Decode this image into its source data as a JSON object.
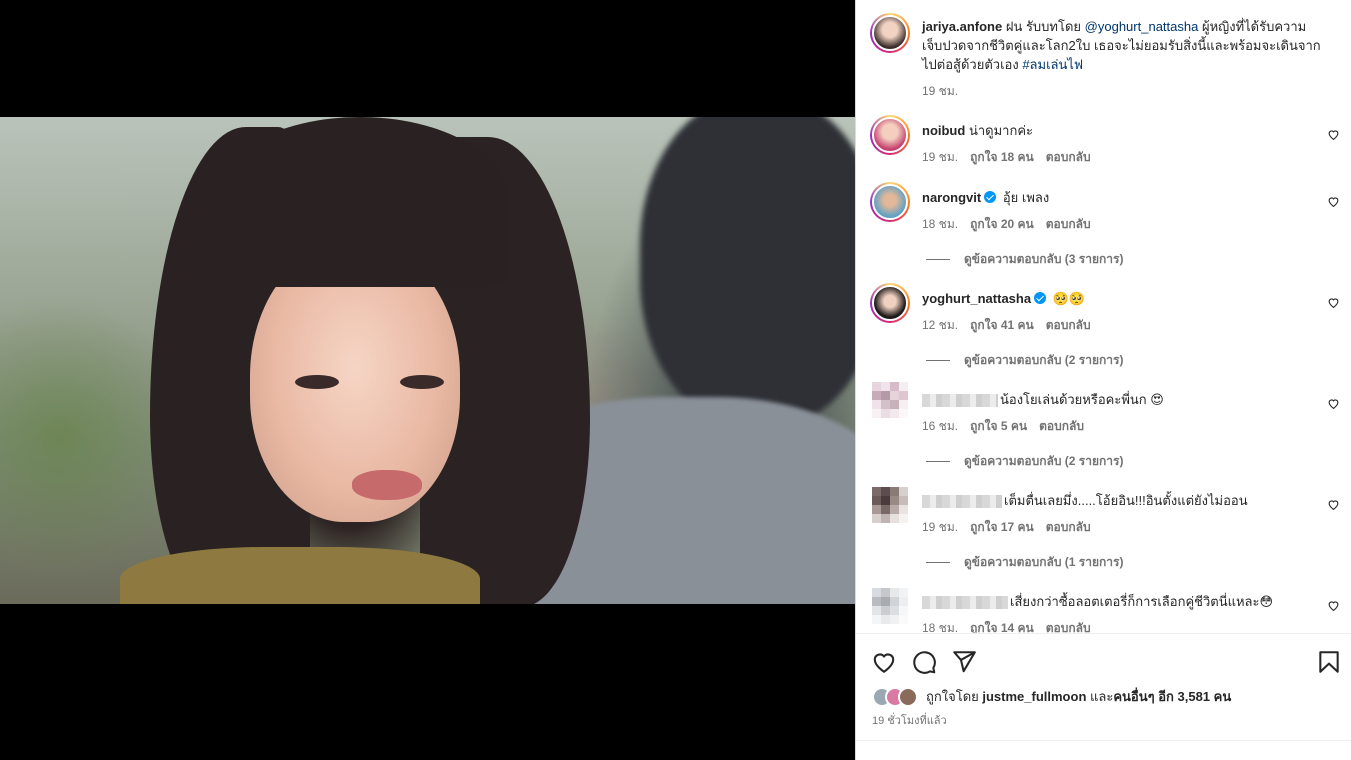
{
  "post": {
    "author": "jariya.anfone",
    "caption_prefix": "ฝน รับบทโดย",
    "mention": "@yoghurt_nattasha",
    "caption_rest": "ผู้หญิงที่ได้รับความเจ็บปวดจากชีวิตคู่และโลก2ใบ เธอจะไม่ยอมรับสิ่งนี้และพร้อมจะเดินจากไปต่อสู้ด้วยตัวเอง",
    "hashtag": "#ลมเล่นไฟ",
    "time": "19 ชม."
  },
  "comments": [
    {
      "user": "noibud",
      "verified": false,
      "text": "น่าดูมากค่ะ",
      "time": "19 ชม.",
      "likes": "ถูกใจ 18 คน",
      "reply": "ตอบกลับ",
      "view_replies": ""
    },
    {
      "user": "narongvit",
      "verified": true,
      "text": "อุ้ย เพลง",
      "time": "18 ชม.",
      "likes": "ถูกใจ 20 คน",
      "reply": "ตอบกลับ",
      "view_replies": "ดูข้อความตอบกลับ (3 รายการ)"
    },
    {
      "user": "yoghurt_nattasha",
      "verified": true,
      "text": "🥺🥺",
      "time": "12 ชม.",
      "likes": "ถูกใจ 41 คน",
      "reply": "ตอบกลับ",
      "view_replies": "ดูข้อความตอบกลับ (2 รายการ)"
    },
    {
      "user": "",
      "verified": false,
      "text": "น้องโยเล่นด้วยหรือคะพี่นก 😍",
      "time": "16 ชม.",
      "likes": "ถูกใจ 5 คน",
      "reply": "ตอบกลับ",
      "view_replies": "ดูข้อความตอบกลับ (2 รายการ)"
    },
    {
      "user": "",
      "verified": false,
      "text": "เต็มตื่นเลยมึ่ง.....โอ้ยอิน!!!อินตั้งแต่ยังไม่ออน",
      "time": "19 ชม.",
      "likes": "ถูกใจ 17 คน",
      "reply": "ตอบกลับ",
      "view_replies": "ดูข้อความตอบกลับ (1 รายการ)"
    },
    {
      "user": "",
      "verified": false,
      "text": "เสี่ยงกว่าซื้อลอตเตอรี่ก็การเลือกคู่ชีวิตนี่แหละ😳",
      "time": "18 ชม.",
      "likes": "ถูกใจ 14 คน",
      "reply": "ตอบกลับ",
      "view_replies": ""
    }
  ],
  "likes_summary": {
    "prefix": "ถูกใจโดย",
    "user": "justme_fullmoon",
    "middle": "และ",
    "others": "คนอื่นๆ อีก 3,581 คน"
  },
  "time_ago": "19 ชั่วโมงที่แล้ว",
  "icons": {
    "like": "heart-icon",
    "comment": "comment-icon",
    "share": "share-icon",
    "save": "bookmark-icon",
    "mute": "speaker-icon"
  },
  "colors": {
    "link": "#00376b",
    "muted": "#737373",
    "verified": "#0095f6",
    "text": "#262626"
  }
}
